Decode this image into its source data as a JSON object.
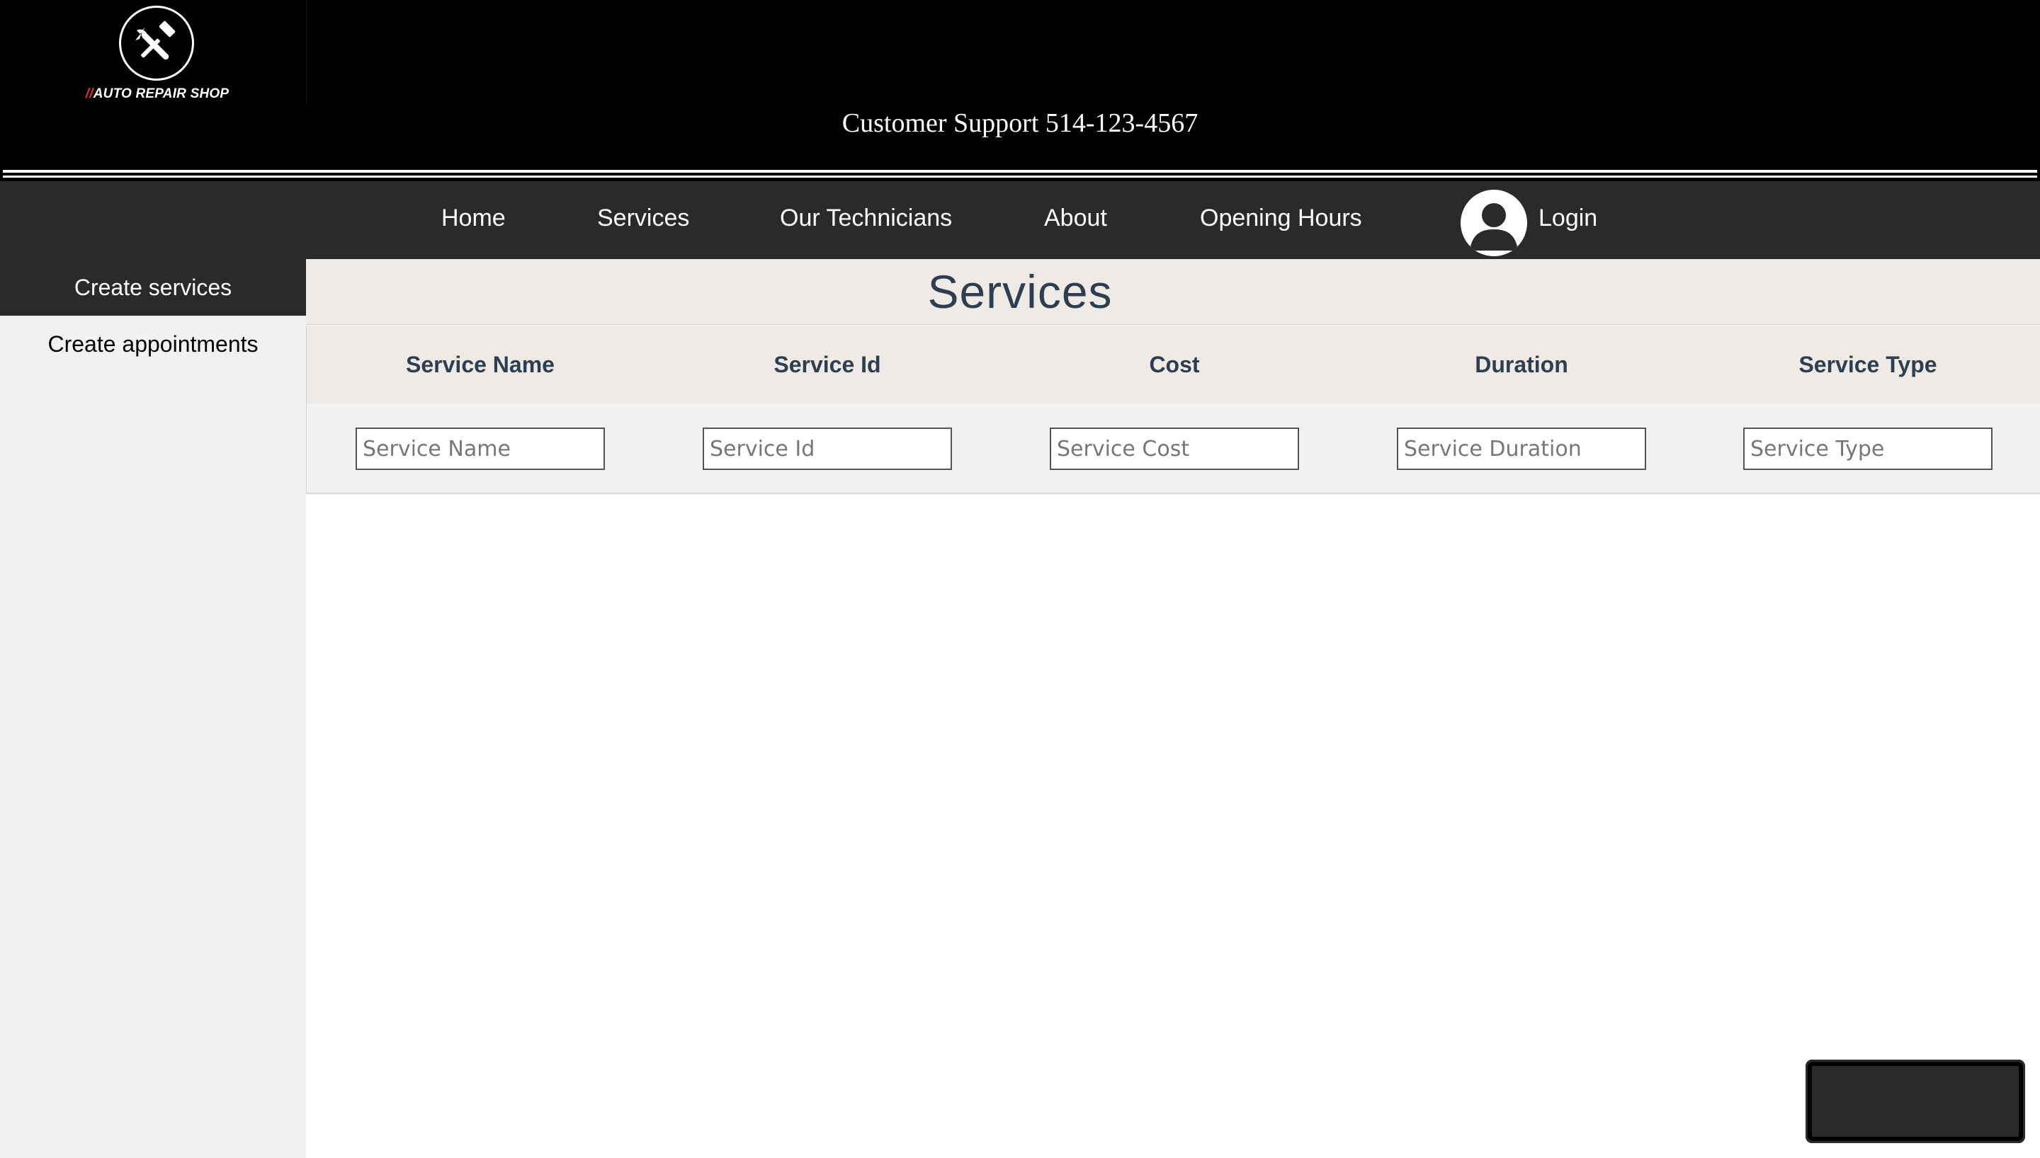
{
  "header": {
    "logo": {
      "slashes": "//",
      "text": "AUTO REPAIR SHOP",
      "icon": "tools-icon"
    },
    "support_text": "Customer Support 514-123-4567"
  },
  "nav": {
    "items": [
      {
        "label": "Home"
      },
      {
        "label": "Services"
      },
      {
        "label": "Our Technicians"
      },
      {
        "label": "About"
      },
      {
        "label": "Opening Hours"
      }
    ],
    "login": {
      "label": "Login",
      "icon": "user-avatar-icon"
    }
  },
  "sidebar": {
    "items": [
      {
        "label": "Create services",
        "active": true
      },
      {
        "label": "Create appointments",
        "active": false
      }
    ]
  },
  "main": {
    "title": "Services",
    "columns": [
      "Service Name",
      "Service Id",
      "Cost",
      "Duration",
      "Service Type"
    ],
    "inputs": [
      {
        "placeholder": "Service Name",
        "value": ""
      },
      {
        "placeholder": "Service Id",
        "value": ""
      },
      {
        "placeholder": "Service Cost",
        "value": ""
      },
      {
        "placeholder": "Service Duration",
        "value": ""
      },
      {
        "placeholder": "Service Type",
        "value": ""
      }
    ]
  },
  "colors": {
    "header_bg": "#000000",
    "nav_bg": "#2a2a2a",
    "sidebar_bg": "#f1f1f1",
    "table_header_bg": "#efeae6",
    "heading_text": "#2c3e50",
    "logo_accent": "#e0362c"
  }
}
